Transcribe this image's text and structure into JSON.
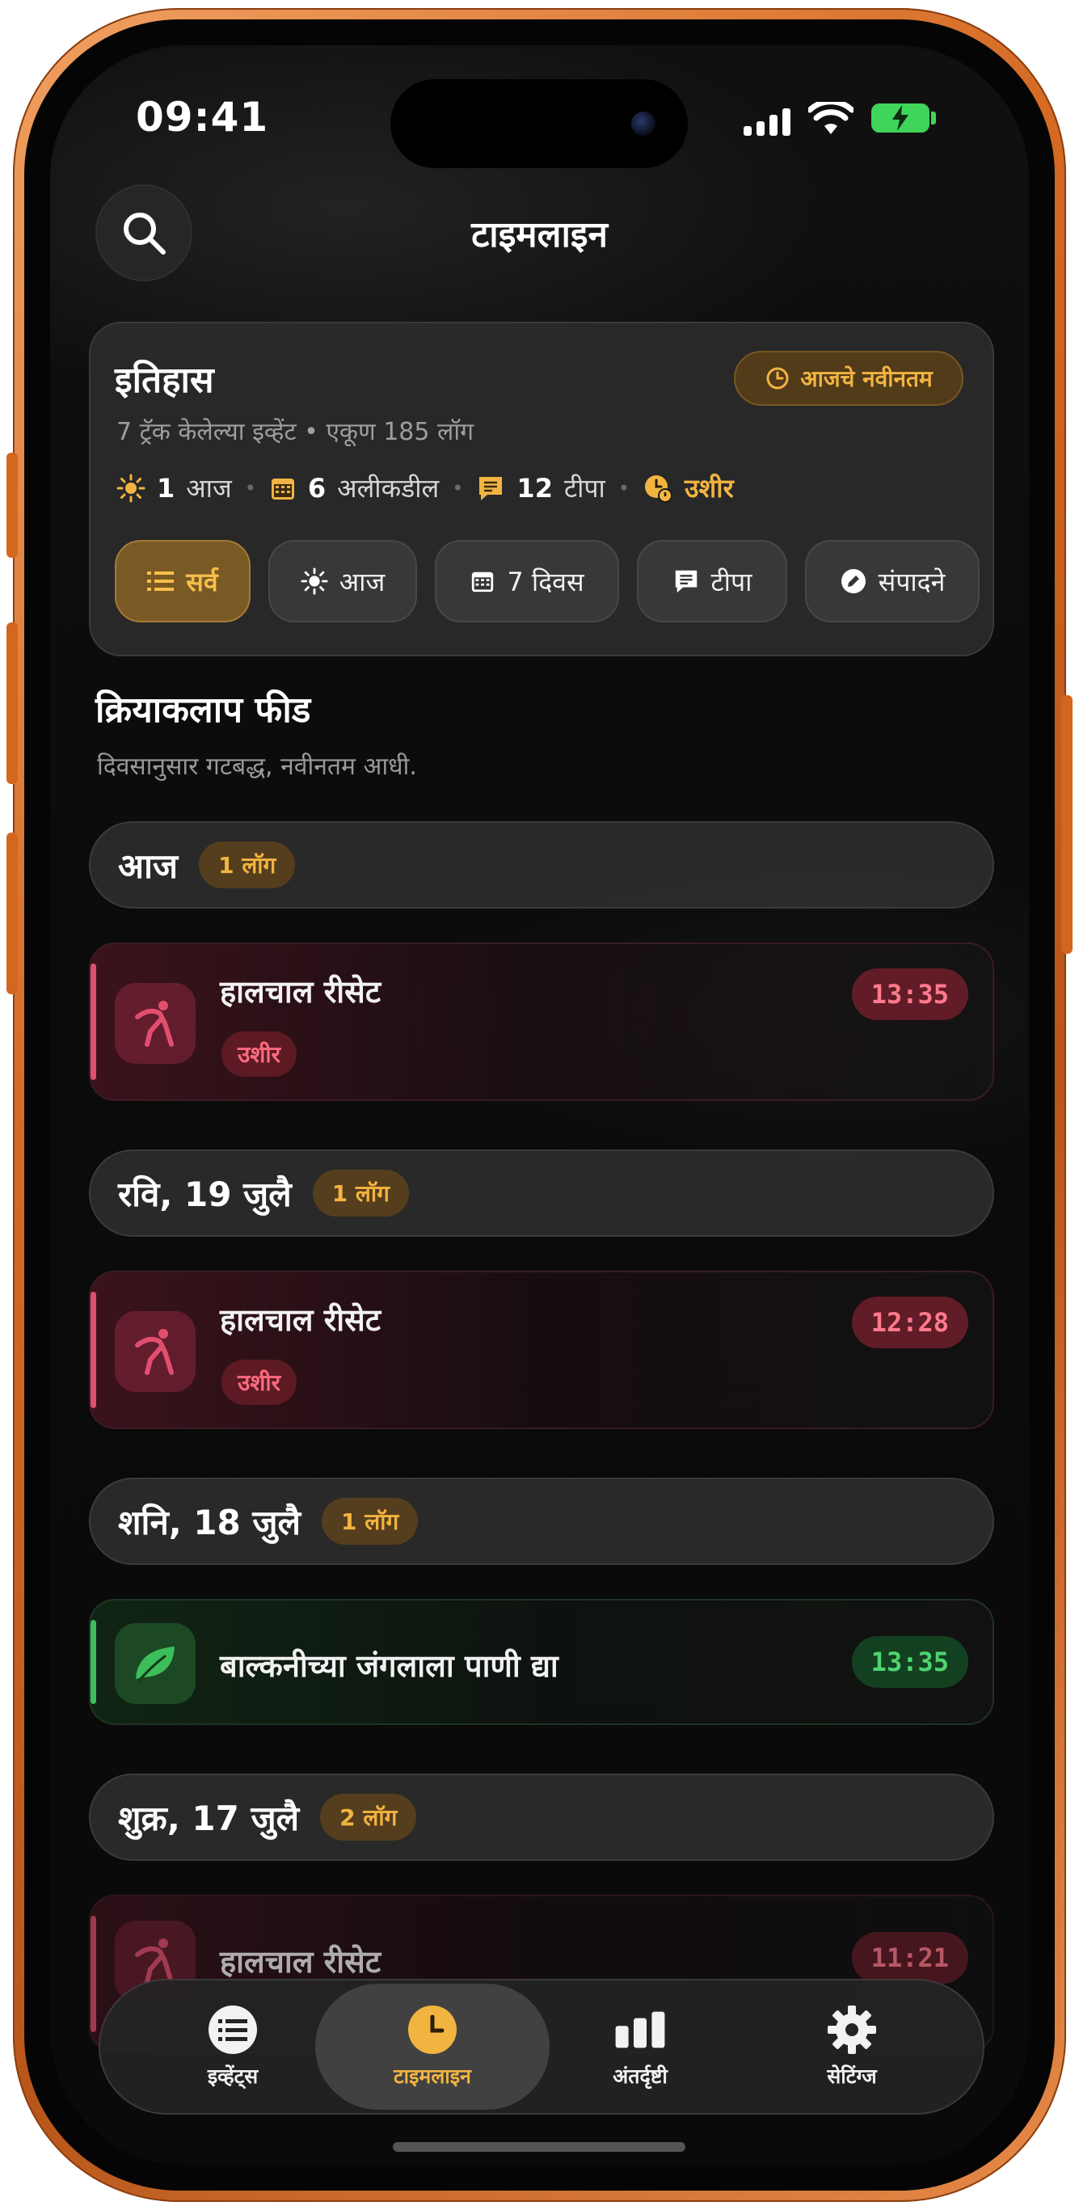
{
  "status_bar": {
    "time": "09:41"
  },
  "header": {
    "title": "टाइमलाइन"
  },
  "history": {
    "title": "इतिहास",
    "newest_label": "आजचे नवीनतम",
    "subtitle": "7 ट्रॅक केलेल्या इव्हेंट • एकूण 185 लॉग",
    "stats": {
      "today_count": "1",
      "today_label": "आज",
      "recent_count": "6",
      "recent_label": "अलीकडील",
      "notes_count": "12",
      "notes_label": "टीपा",
      "late_label": "उशीर"
    },
    "filters": {
      "all": "सर्व",
      "today": "आज",
      "seven_days": "7 दिवस",
      "notes": "टीपा",
      "edits": "संपादने"
    }
  },
  "feed": {
    "title": "क्रियाकलाप फीड",
    "subtitle": "दिवसानुसार गटबद्ध, नवीनतम आधी.",
    "groups": [
      {
        "label": "आज",
        "count": "1 लॉग"
      },
      {
        "label": "रवि, 19 जुलै",
        "count": "1 लॉग"
      },
      {
        "label": "शनि, 18 जुलै",
        "count": "1 लॉग"
      },
      {
        "label": "शुक्र, 17 जुलै",
        "count": "2 लॉग"
      }
    ],
    "entries": [
      {
        "title": "हालचाल रीसेट",
        "badge": "उशीर",
        "time": "13:35"
      },
      {
        "title": "हालचाल रीसेट",
        "badge": "उशीर",
        "time": "12:28"
      },
      {
        "title": "बाल्कनीच्या जंगलाला पाणी द्या",
        "time": "13:35"
      },
      {
        "title": "हालचाल रीसेट",
        "time": "11:21"
      }
    ]
  },
  "tabs": {
    "events": "इव्हेंट्स",
    "timeline": "टाइमलाइन",
    "insights": "अंतर्दृष्टी",
    "settings": "सेटिंग्ज"
  },
  "colors": {
    "accent": "#f2b441",
    "late": "#e24f6e",
    "ok": "#3cbf5a",
    "frame": "#d56a24"
  }
}
